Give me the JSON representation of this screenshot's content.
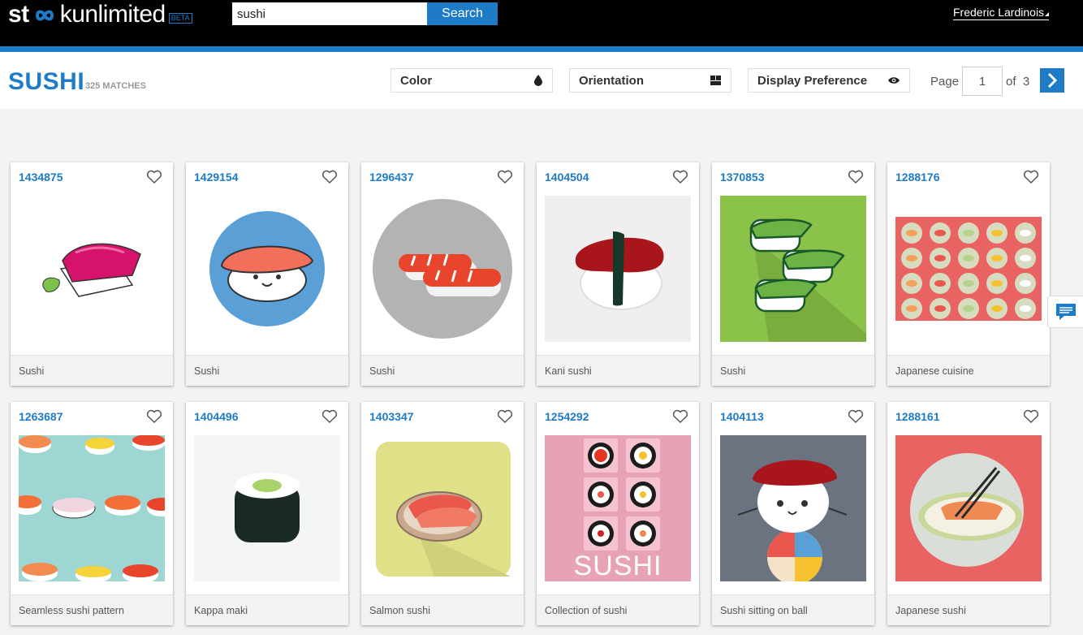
{
  "app": {
    "logo_left": "st",
    "logo_right": "kunlimited",
    "beta": "BETA"
  },
  "search": {
    "value": "sushi",
    "button": "Search"
  },
  "user": {
    "name": "Frederic Lardinois"
  },
  "page": {
    "title": "SUSHI",
    "matches": "325 MATCHES"
  },
  "filters": {
    "color": "Color",
    "orientation": "Orientation",
    "display": "Display Preference"
  },
  "pagination": {
    "page_label": "Page",
    "current": "1",
    "of_label": "of",
    "total": "3"
  },
  "colors": {
    "accent": "#1d7bc8"
  },
  "cards": [
    {
      "id": "1434875",
      "title": "Sushi"
    },
    {
      "id": "1429154",
      "title": "Sushi"
    },
    {
      "id": "1296437",
      "title": "Sushi"
    },
    {
      "id": "1404504",
      "title": "Kani sushi"
    },
    {
      "id": "1370853",
      "title": "Sushi"
    },
    {
      "id": "1288176",
      "title": "Japanese cuisine"
    },
    {
      "id": "1263687",
      "title": "Seamless sushi pattern"
    },
    {
      "id": "1404496",
      "title": "Kappa maki"
    },
    {
      "id": "1403347",
      "title": "Salmon sushi"
    },
    {
      "id": "1254292",
      "title": "Collection of sushi"
    },
    {
      "id": "1404113",
      "title": "Sushi sitting on ball"
    },
    {
      "id": "1288161",
      "title": "Japanese sushi"
    }
  ],
  "thumb4_text": "SUSHI"
}
